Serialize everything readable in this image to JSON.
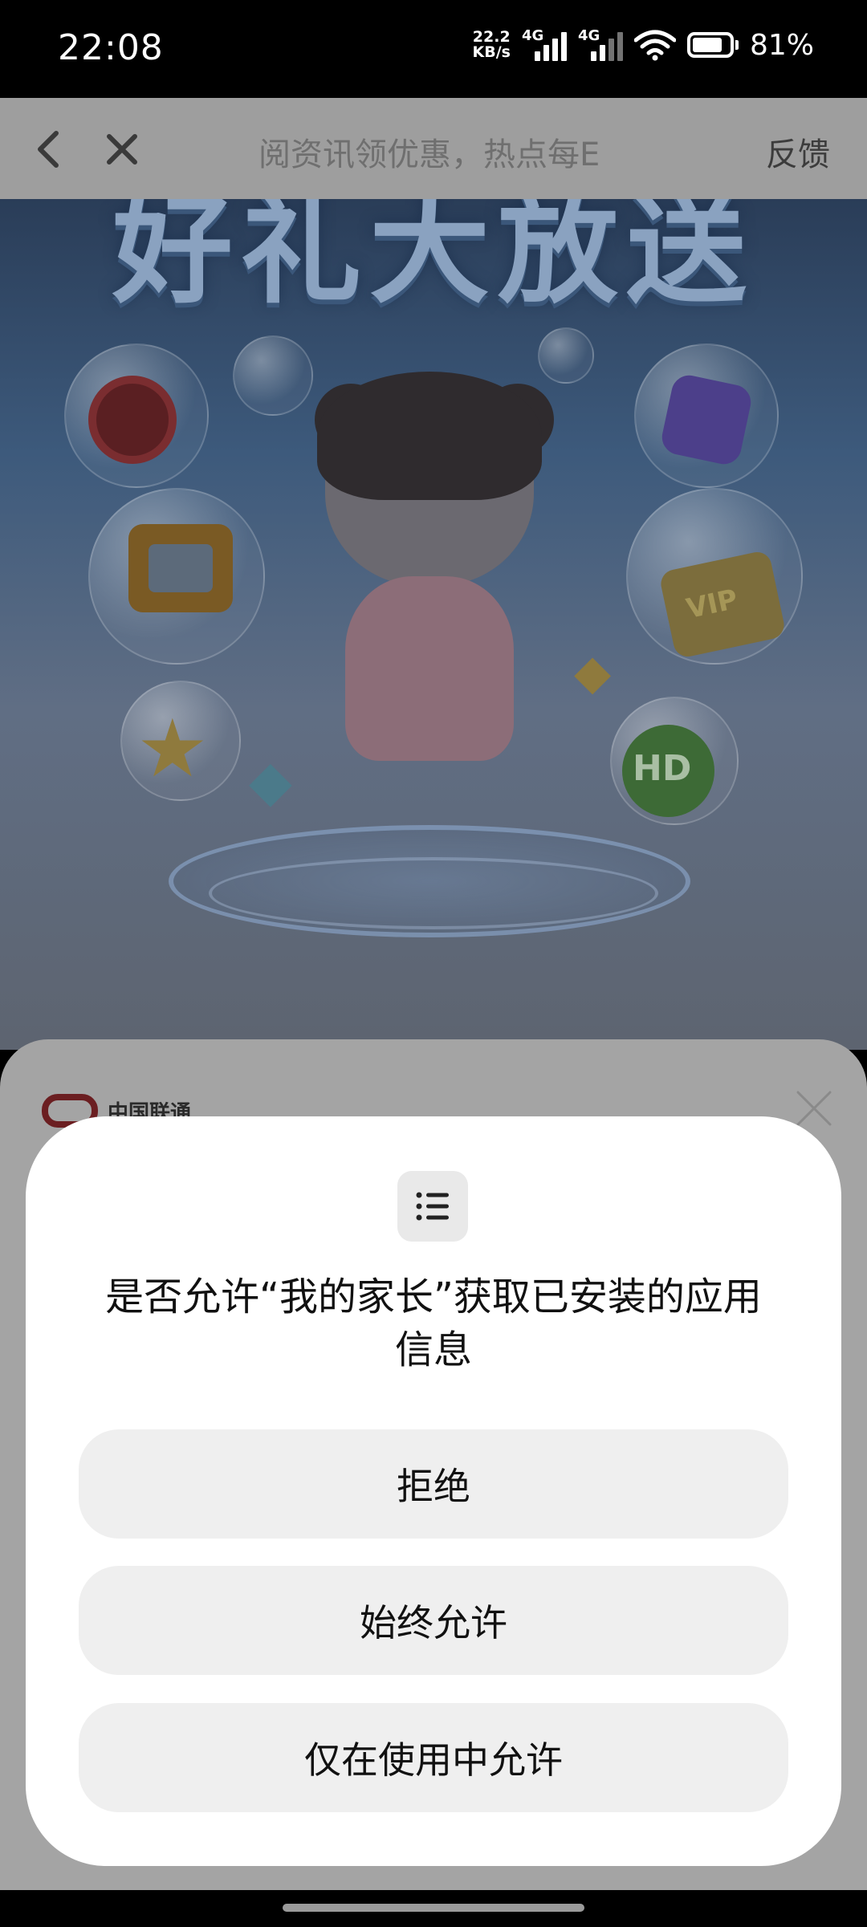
{
  "status_bar": {
    "time": "22:08",
    "net_speed_value": "22.2",
    "net_speed_unit": "KB/s",
    "sim1_tag": "4G",
    "sim2_tag": "4G",
    "battery_percent": "81%",
    "battery_level": 0.81
  },
  "nav": {
    "title": "阅资讯领优惠，热点每E",
    "feedback_label": "反馈",
    "back_icon": "chevron-left-icon",
    "close_icon": "close-icon"
  },
  "banner": {
    "title": "好礼大放送",
    "vip_label": "VIP",
    "hd_label": "HD"
  },
  "sheet": {
    "logo_text": "中国联通",
    "close_icon": "close-icon"
  },
  "dialog": {
    "icon": "app-list-icon",
    "title": "是否允许“我的家长”获取已安装的应用信息",
    "deny_label": "拒绝",
    "always_allow_label": "始终允许",
    "allow_while_using_label": "仅在使用中允许"
  }
}
